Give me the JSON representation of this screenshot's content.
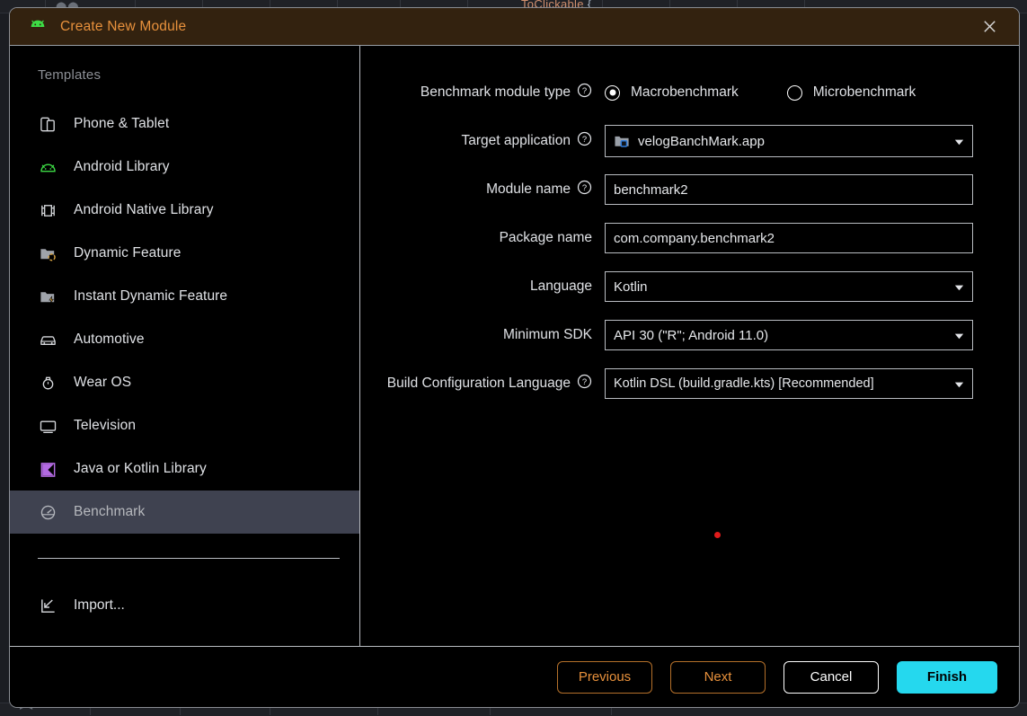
{
  "backdrop": {
    "ghost_title": "ToClickable",
    "ghost_brace": "{",
    "dots": "⬤⬤",
    "bottom_ghost": "▸ ◂"
  },
  "dialog": {
    "title": "Create New Module",
    "android_icon": "android-robot-icon",
    "close_icon": "close-icon"
  },
  "sidebar": {
    "heading": "Templates",
    "items": [
      {
        "label": "Phone & Tablet",
        "icon": "phone-tablet-icon",
        "selected": false
      },
      {
        "label": "Android Library",
        "icon": "android-robot-icon",
        "selected": false
      },
      {
        "label": "Android Native Library",
        "icon": "native-chip-icon",
        "selected": false
      },
      {
        "label": "Dynamic Feature",
        "icon": "dynamic-feature-folder-icon",
        "selected": false
      },
      {
        "label": "Instant Dynamic Feature",
        "icon": "instant-feature-folder-icon",
        "selected": false
      },
      {
        "label": "Automotive",
        "icon": "car-icon",
        "selected": false
      },
      {
        "label": "Wear OS",
        "icon": "watch-icon",
        "selected": false
      },
      {
        "label": "Television",
        "icon": "television-icon",
        "selected": false
      },
      {
        "label": "Java or Kotlin Library",
        "icon": "kotlin-icon",
        "selected": false
      },
      {
        "label": "Benchmark",
        "icon": "gauge-icon",
        "selected": true
      }
    ],
    "import_label": "Import...",
    "import_icon": "import-arrow-icon"
  },
  "form": {
    "module_type": {
      "label": "Benchmark module type",
      "help_icon": "help-icon",
      "options": [
        {
          "label": "Macrobenchmark",
          "selected": true
        },
        {
          "label": "Microbenchmark",
          "selected": false
        }
      ]
    },
    "target_application": {
      "label": "Target application",
      "help_icon": "help-icon",
      "value": "velogBanchMark.app",
      "value_icon": "module-folder-icon",
      "dropdown_icon": "chevron-down-icon"
    },
    "module_name": {
      "label": "Module name",
      "help_icon": "help-icon",
      "value": "benchmark2"
    },
    "package_name": {
      "label": "Package name",
      "value": "com.company.benchmark2"
    },
    "language": {
      "label": "Language",
      "value": "Kotlin",
      "dropdown_icon": "chevron-down-icon"
    },
    "minimum_sdk": {
      "label": "Minimum SDK",
      "value": "API 30 (\"R\"; Android 11.0)",
      "dropdown_icon": "chevron-down-icon"
    },
    "build_config": {
      "label": "Build Configuration Language",
      "help_icon": "help-icon",
      "value": "Kotlin DSL (build.gradle.kts) [Recommended]",
      "dropdown_icon": "chevron-down-icon"
    },
    "cursor_marker": "red-dot-marker"
  },
  "footer": {
    "previous": "Previous",
    "next": "Next",
    "cancel": "Cancel",
    "finish": "Finish"
  },
  "colors": {
    "title_bar_bg": "#33220f",
    "title_text": "#e8913c",
    "selected_row": "#3f4250",
    "primary_button": "#25d8ee",
    "marker_red": "#e01b1b",
    "android_green": "#3ddc45",
    "kotlin_purple": "#b36ae2",
    "badge_blue": "#2f7bd8"
  }
}
